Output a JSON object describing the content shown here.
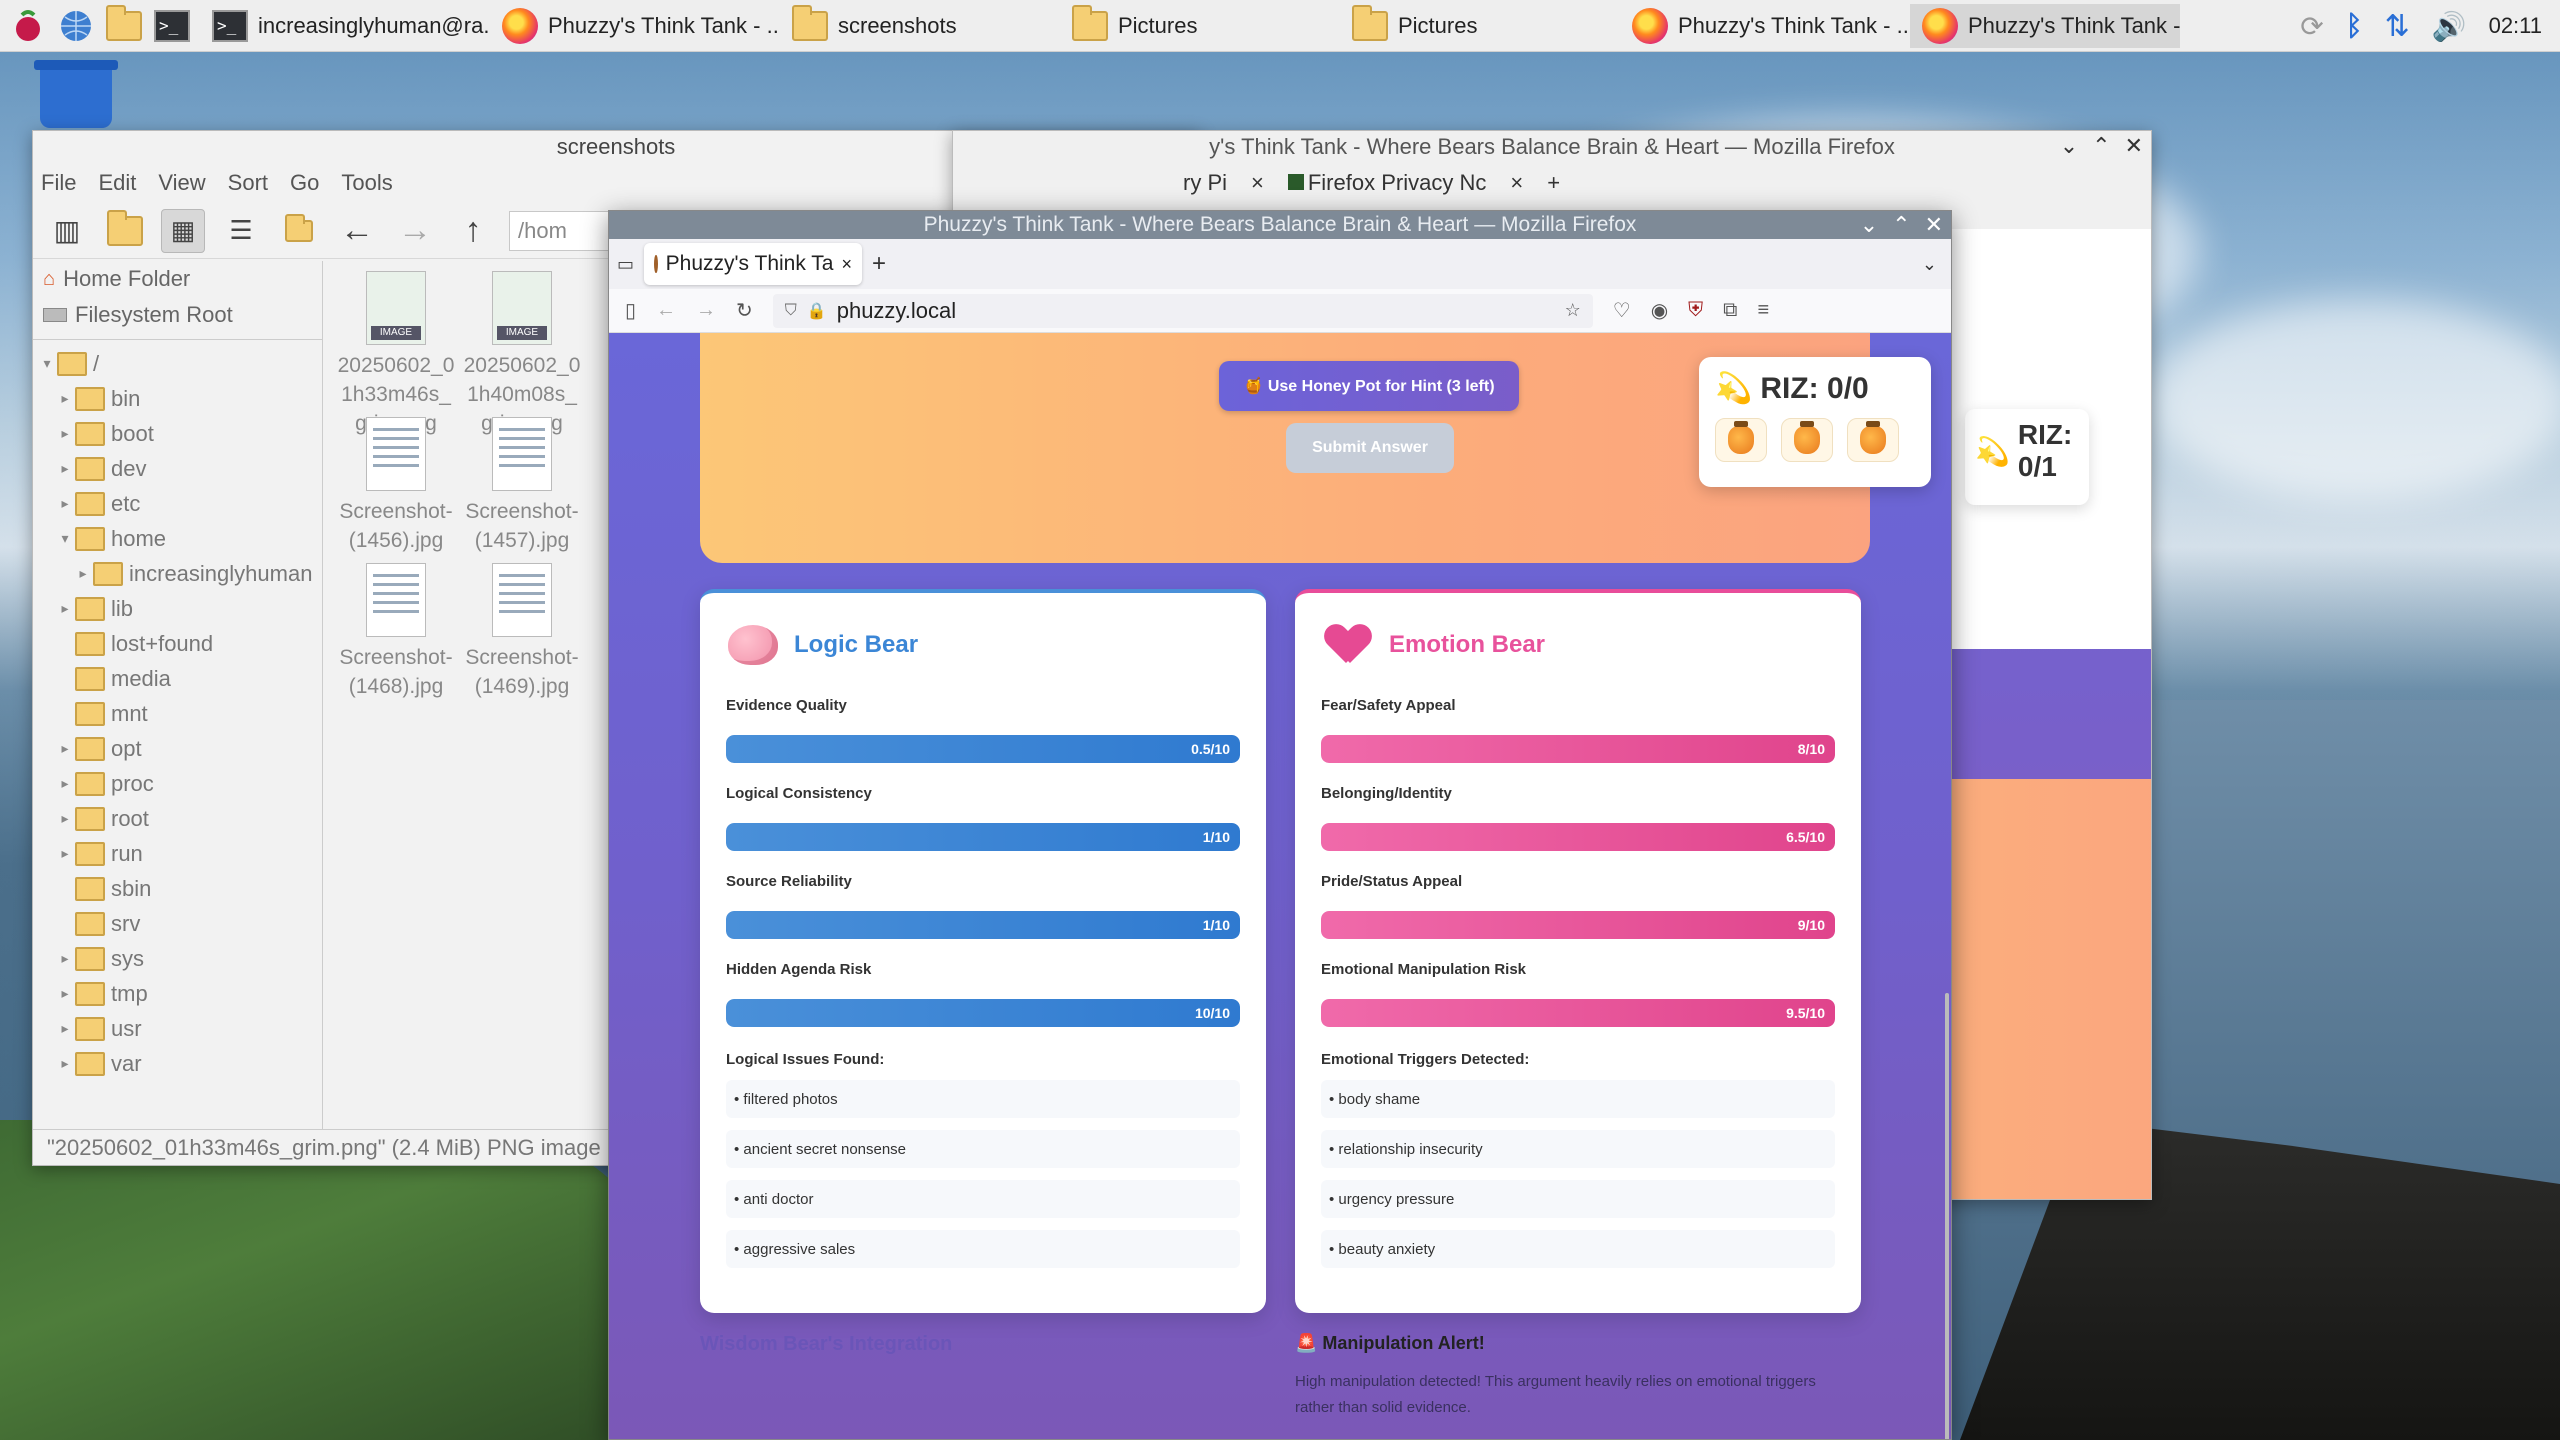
{
  "taskbar": {
    "tasks": [
      {
        "label": "increasinglyhuman@ra...",
        "icon": "terminal-icon"
      },
      {
        "label": "Phuzzy's Think Tank - ...",
        "icon": "firefox-icon"
      },
      {
        "label": "screenshots",
        "icon": "folder-icon"
      },
      {
        "label": "Pictures",
        "icon": "folder-icon"
      },
      {
        "label": "Pictures",
        "icon": "folder-icon"
      },
      {
        "label": "Phuzzy's Think Tank - ...",
        "icon": "firefox-icon"
      },
      {
        "label": "Phuzzy's Think Tank - ...",
        "icon": "firefox-icon"
      }
    ],
    "clock": "02:11"
  },
  "file_manager": {
    "title": "screenshots",
    "menu": [
      "File",
      "Edit",
      "View",
      "Sort",
      "Go",
      "Tools"
    ],
    "path": "/hom",
    "places": [
      "Home Folder",
      "Filesystem Root"
    ],
    "tree": [
      "/",
      "bin",
      "boot",
      "dev",
      "etc",
      "home",
      "increasinglyhuman",
      "lib",
      "lost+found",
      "media",
      "mnt",
      "opt",
      "proc",
      "root",
      "run",
      "sbin",
      "srv",
      "sys",
      "tmp",
      "usr",
      "var"
    ],
    "files": [
      {
        "name": "20250602_01h33m46s_grim.png",
        "l1": "20250602_0",
        "l2": "1h33m46s_",
        "l3": "grim.png",
        "kind": "img"
      },
      {
        "name": "20250602_01h40m08s_grim.png",
        "l1": "20250602_0",
        "l2": "1h40m08s_",
        "l3": "grim.png",
        "kind": "img"
      },
      {
        "name": "Screenshot-(1456).jpg",
        "l1": "Screenshot-",
        "l2": "(1456).jpg",
        "l3": "",
        "kind": "doc"
      },
      {
        "name": "Screenshot-(1457).jpg",
        "l1": "Screenshot-",
        "l2": "(1457).jpg",
        "l3": "",
        "kind": "doc"
      },
      {
        "name": "Screenshot-(1468).jpg",
        "l1": "Screenshot-",
        "l2": "(1468).jpg",
        "l3": "",
        "kind": "doc"
      },
      {
        "name": "Screenshot-(1469).jpg",
        "l1": "Screenshot-",
        "l2": "(1469).jpg",
        "l3": "",
        "kind": "doc"
      }
    ],
    "status": "\"20250602_01h33m46s_grim.png\" (2.4 MiB) PNG image"
  },
  "back_browser": {
    "title": "y's Think Tank - Where Bears Balance Brain & Heart — Mozilla Firefox",
    "tabs": [
      "ry Pi",
      "Firefox Privacy Nc"
    ],
    "riz": "RIZ: 0/1"
  },
  "browser": {
    "title": "Phuzzy's Think Tank - Where Bears Balance Brain & Heart — Mozilla Firefox",
    "tab": "Phuzzy's Think Ta",
    "url": "phuzzy.local"
  },
  "page": {
    "hint_button": "🍯 Use Honey Pot for Hint (3 left)",
    "submit_button": "Submit Answer",
    "riz": "RIZ: 0/0",
    "logic": {
      "title": "Logic Bear",
      "metrics": [
        {
          "label": "Evidence Quality",
          "value": "0.5/10",
          "score": 0.5
        },
        {
          "label": "Logical Consistency",
          "value": "1/10",
          "score": 1
        },
        {
          "label": "Source Reliability",
          "value": "1/10",
          "score": 1
        },
        {
          "label": "Hidden Agenda Risk",
          "value": "10/10",
          "score": 10
        }
      ],
      "issues_title": "Logical Issues Found:",
      "issues": [
        "• filtered photos",
        "• ancient secret nonsense",
        "• anti doctor",
        "• aggressive sales"
      ]
    },
    "emotion": {
      "title": "Emotion Bear",
      "metrics": [
        {
          "label": "Fear/Safety Appeal",
          "value": "8/10",
          "score": 8
        },
        {
          "label": "Belonging/Identity",
          "value": "6.5/10",
          "score": 6.5
        },
        {
          "label": "Pride/Status Appeal",
          "value": "9/10",
          "score": 9
        },
        {
          "label": "Emotional Manipulation Risk",
          "value": "9.5/10",
          "score": 9.5
        }
      ],
      "issues_title": "Emotional Triggers Detected:",
      "issues": [
        "• body shame",
        "• relationship insecurity",
        "• urgency pressure",
        "• beauty anxiety"
      ]
    },
    "wisdom_title": "Wisdom Bear's Integration",
    "alert_title": "🚨 Manipulation Alert!",
    "alert_text": "High manipulation detected! This argument heavily relies on emotional triggers rather than solid evidence."
  }
}
